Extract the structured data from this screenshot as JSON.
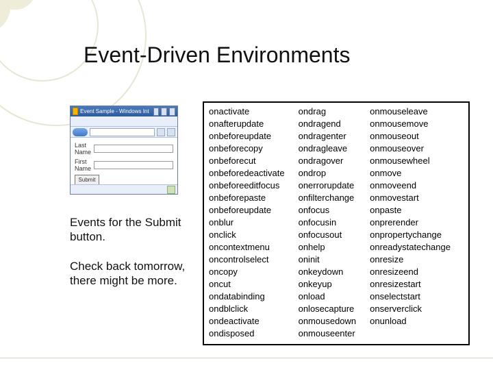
{
  "title": "Event-Driven Environments",
  "screenshot": {
    "window_title": "Event Sample - Windows Internet Explore",
    "field1_label": "Last Name",
    "field2_label": "First Name",
    "submit_label": "Submit"
  },
  "caption1": "Events for the Submit button.",
  "caption2": "Check back tomorrow, there might be more.",
  "events": {
    "col1": [
      "onactivate",
      "onafterupdate",
      "onbeforeupdate",
      "onbeforecopy",
      "onbeforecut",
      "onbeforedeactivate",
      "onbeforeeditfocus",
      "onbeforepaste",
      "onbeforeupdate",
      "onblur",
      "onclick",
      "oncontextmenu",
      "oncontrolselect",
      "oncopy",
      "oncut",
      "ondatabinding",
      "ondblclick",
      "ondeactivate",
      "ondisposed"
    ],
    "col2": [
      "ondrag",
      "ondragend",
      "ondragenter",
      "ondragleave",
      "ondragover",
      "ondrop",
      "onerrorupdate",
      "onfilterchange",
      "onfocus",
      "onfocusin",
      "onfocusout",
      "onhelp",
      "oninit",
      "onkeydown",
      "onkeyup",
      "onload",
      "onlosecapture",
      "onmousedown",
      "onmouseenter"
    ],
    "col3": [
      "onmouseleave",
      "onmousemove",
      "onmouseout",
      "onmouseover",
      "onmousewheel",
      "onmove",
      "onmoveend",
      "onmovestart",
      "onpaste",
      "onprerender",
      "onpropertychange",
      "onreadystatechange",
      "onresize",
      "onresizeend",
      "onresizestart",
      "onselectstart",
      "onserverclick",
      "onunload"
    ]
  }
}
